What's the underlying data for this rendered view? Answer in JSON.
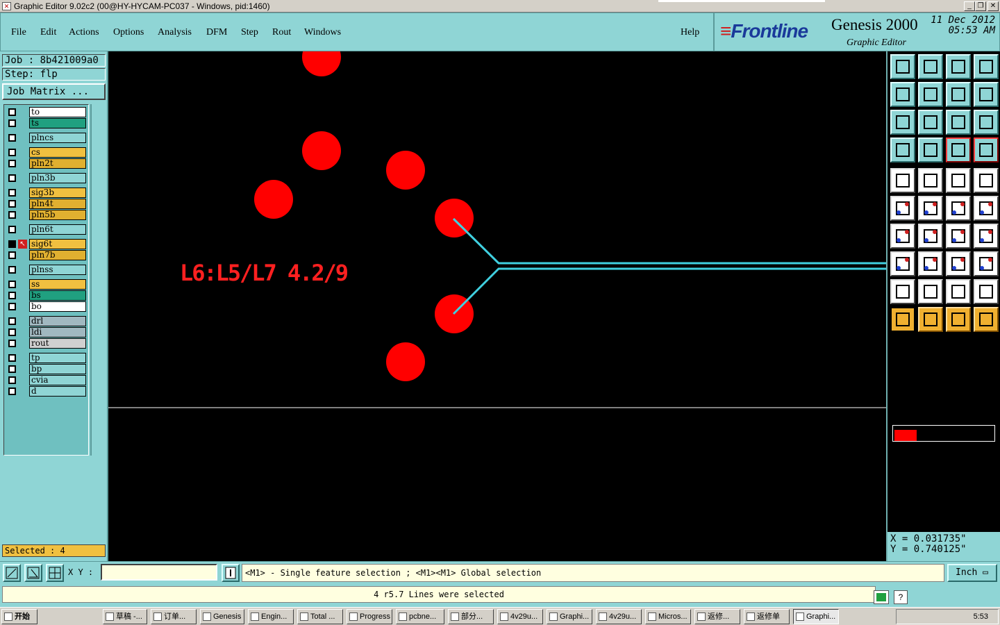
{
  "window": {
    "title": "Graphic Editor 9.02c2 (00@HY-HYCAM-PC037 - Windows, pid:1460)",
    "controls": [
      "_",
      "❐",
      "✕"
    ]
  },
  "menubar": {
    "items": [
      "File",
      "Edit",
      "Actions",
      "Options",
      "Analysis",
      "DFM",
      "Step",
      "Rout",
      "Windows"
    ],
    "help": "Help"
  },
  "brand": {
    "logo": "Frontline",
    "product": "Genesis 2000",
    "subtitle": "Graphic Editor",
    "date": "11 Dec 2012",
    "time": "05:53 AM"
  },
  "leftpanel": {
    "job": "Job  : 8b421009a0",
    "step": "Step: flp",
    "job_matrix_button": "Job Matrix ...",
    "selected": "Selected : 4",
    "layers": [
      {
        "name": "to",
        "color": "#ffffff"
      },
      {
        "name": "ts",
        "color": "#20a080"
      },
      {
        "name": "plncs",
        "color": "#8fd5d5"
      },
      {
        "name": "cs",
        "color": "#f0c040"
      },
      {
        "name": "pln2t",
        "color": "#e0b030"
      },
      {
        "name": "pln3b",
        "color": "#8fd5d5"
      },
      {
        "name": "sig3b",
        "color": "#f0c040"
      },
      {
        "name": "pln4t",
        "color": "#e0b030"
      },
      {
        "name": "pln5b",
        "color": "#e0b030"
      },
      {
        "name": "pln6t",
        "color": "#8fd5d5"
      },
      {
        "name": "sig6t",
        "color": "#f0c040"
      },
      {
        "name": "pln7b",
        "color": "#e0b030"
      },
      {
        "name": "plnss",
        "color": "#8fd5d5"
      },
      {
        "name": "ss",
        "color": "#f0c040"
      },
      {
        "name": "bs",
        "color": "#20a080"
      },
      {
        "name": "bo",
        "color": "#ffffff"
      },
      {
        "name": "drl",
        "color": "#a0b8c0"
      },
      {
        "name": "ldi",
        "color": "#a0b8c0"
      },
      {
        "name": "rout",
        "color": "#d0d0d0"
      },
      {
        "name": "tp",
        "color": "#8fd5d5"
      },
      {
        "name": "bp",
        "color": "#8fd5d5"
      },
      {
        "name": "cvia",
        "color": "#8fd5d5"
      },
      {
        "name": "d",
        "color": "#8fd5d5"
      }
    ]
  },
  "canvas": {
    "annotation": "L6:L5/L7 4.2/9",
    "pad_color": "#ff0000",
    "trace_color": "#40d0e0"
  },
  "rightpanel": {
    "x": "X = 0.031735\"",
    "y": "Y = 0.740125\""
  },
  "bottombar": {
    "xy_label": "X Y :",
    "xy_value": "",
    "hint": "<M1> - Single feature selection ; <M1><M1> Global selection",
    "unit": "Inch"
  },
  "status": {
    "message": "4 r5.7 Lines were selected"
  },
  "taskbar": {
    "start": "开始",
    "items": [
      "草稿 -...",
      "订单...",
      "Genesis",
      "Engin...",
      "Total ...",
      "Progress",
      "pcbne...",
      "部分...",
      "4v29u...",
      "Graphi...",
      "4v29u...",
      "Micros...",
      "返修...",
      "返修单",
      "Graphi..."
    ],
    "clock": "5:53"
  }
}
